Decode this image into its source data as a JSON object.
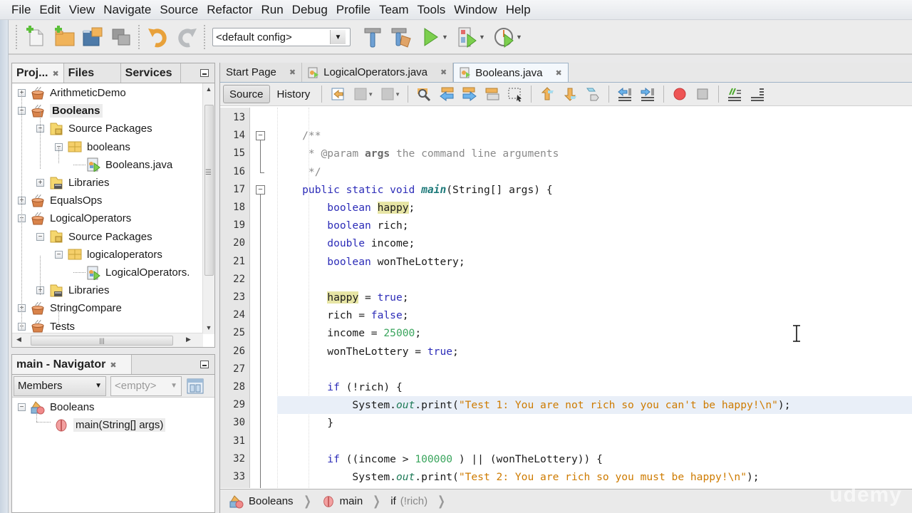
{
  "menubar": {
    "items": [
      "File",
      "Edit",
      "View",
      "Navigate",
      "Source",
      "Refactor",
      "Run",
      "Debug",
      "Profile",
      "Team",
      "Tools",
      "Window",
      "Help"
    ]
  },
  "toolbar": {
    "config_value": "<default config>",
    "buttons": [
      {
        "name": "new-file",
        "icon": "new-file-icon"
      },
      {
        "name": "new-project",
        "icon": "new-project-icon"
      },
      {
        "name": "open-project",
        "icon": "open-project-icon"
      },
      {
        "name": "close-project",
        "icon": "close-project-icon"
      },
      {
        "name": "undo",
        "icon": "undo-icon"
      },
      {
        "name": "redo",
        "icon": "redo-icon"
      },
      {
        "name": "build",
        "icon": "hammer-icon"
      },
      {
        "name": "clean-build",
        "icon": "clean-build-icon"
      },
      {
        "name": "run",
        "icon": "run-icon"
      },
      {
        "name": "debug",
        "icon": "debug-icon"
      },
      {
        "name": "profile",
        "icon": "profile-icon"
      }
    ]
  },
  "projects_panel": {
    "tabs": [
      {
        "label": "Proj...",
        "active": true
      },
      {
        "label": "Files",
        "active": false
      },
      {
        "label": "Services",
        "active": false
      }
    ],
    "tree": [
      {
        "label": "ArithmeticDemo",
        "type": "project",
        "level": 0,
        "expanded": false
      },
      {
        "label": "Booleans",
        "type": "project",
        "level": 0,
        "expanded": true,
        "selected": true
      },
      {
        "label": "Source Packages",
        "type": "source-folder",
        "level": 1,
        "expanded": true
      },
      {
        "label": "booleans",
        "type": "package",
        "level": 2,
        "expanded": true
      },
      {
        "label": "Booleans.java",
        "type": "java-file",
        "level": 3
      },
      {
        "label": "Libraries",
        "type": "libraries",
        "level": 1,
        "expanded": false
      },
      {
        "label": "EqualsOps",
        "type": "project",
        "level": 0,
        "expanded": false
      },
      {
        "label": "LogicalOperators",
        "type": "project",
        "level": 0,
        "expanded": true
      },
      {
        "label": "Source Packages",
        "type": "source-folder",
        "level": 1,
        "expanded": true
      },
      {
        "label": "logicaloperators",
        "type": "package",
        "level": 2,
        "expanded": true
      },
      {
        "label": "LogicalOperators.",
        "type": "java-file",
        "level": 3
      },
      {
        "label": "Libraries",
        "type": "libraries",
        "level": 1,
        "expanded": false
      },
      {
        "label": "StringCompare",
        "type": "project",
        "level": 0,
        "expanded": false
      },
      {
        "label": "Tests",
        "type": "project",
        "level": 0,
        "expanded": true
      }
    ]
  },
  "navigator_panel": {
    "title": "main - Navigator",
    "filter_value": "Members",
    "second_filter": "<empty>",
    "tree": [
      {
        "label": "Booleans",
        "type": "class",
        "level": 0
      },
      {
        "label": "main(String[] args)",
        "type": "method",
        "level": 1,
        "selected": true
      }
    ]
  },
  "editor": {
    "tabs": [
      {
        "label": "Start Page",
        "active": false,
        "icon": false
      },
      {
        "label": "LogicalOperators.java",
        "active": false,
        "icon": true
      },
      {
        "label": "Booleans.java",
        "active": true,
        "icon": true
      }
    ],
    "view_buttons": {
      "source": "Source",
      "history": "History"
    },
    "current_line": 29,
    "lines": [
      {
        "n": "13",
        "t": []
      },
      {
        "n": "14",
        "t": [
          [
            "cmt",
            "    /**"
          ]
        ]
      },
      {
        "n": "15",
        "t": [
          [
            "cmt",
            "     * @param "
          ],
          [
            "cmtb",
            "args"
          ],
          [
            "cmt",
            " the command line arguments"
          ]
        ]
      },
      {
        "n": "16",
        "t": [
          [
            "cmt",
            "     */"
          ]
        ]
      },
      {
        "n": "17",
        "t": [
          [
            "kw",
            "    public static void "
          ],
          [
            "mth",
            "main"
          ],
          [
            "",
            "(String[] args) {"
          ]
        ]
      },
      {
        "n": "18",
        "t": [
          [
            "kw",
            "        boolean "
          ],
          [
            "mark",
            "happy"
          ],
          [
            "",
            ";"
          ]
        ]
      },
      {
        "n": "19",
        "t": [
          [
            "kw",
            "        boolean "
          ],
          [
            "",
            "rich;"
          ]
        ]
      },
      {
        "n": "20",
        "t": [
          [
            "kw",
            "        double "
          ],
          [
            "",
            "income;"
          ]
        ]
      },
      {
        "n": "21",
        "t": [
          [
            "kw",
            "        boolean "
          ],
          [
            "",
            "wonTheLottery;"
          ]
        ]
      },
      {
        "n": "22",
        "t": []
      },
      {
        "n": "23",
        "t": [
          [
            "",
            "        "
          ],
          [
            "mark",
            "happy"
          ],
          [
            "",
            " = "
          ],
          [
            "kw",
            "true"
          ],
          [
            "",
            ";"
          ]
        ]
      },
      {
        "n": "24",
        "t": [
          [
            "",
            "        rich = "
          ],
          [
            "kw",
            "false"
          ],
          [
            "",
            ";"
          ]
        ]
      },
      {
        "n": "25",
        "t": [
          [
            "",
            "        income = "
          ],
          [
            "num",
            "25000"
          ],
          [
            "",
            ";"
          ]
        ]
      },
      {
        "n": "26",
        "t": [
          [
            "",
            "        wonTheLottery = "
          ],
          [
            "kw",
            "true"
          ],
          [
            "",
            ";"
          ]
        ]
      },
      {
        "n": "27",
        "t": []
      },
      {
        "n": "28",
        "t": [
          [
            "kw",
            "        if "
          ],
          [
            "",
            "(!rich) {"
          ]
        ]
      },
      {
        "n": "29",
        "t": [
          [
            "",
            "            System."
          ],
          [
            "fld",
            "out"
          ],
          [
            "",
            ".print("
          ],
          [
            "str",
            "\"Test 1: You are not rich so you can't be happy!\\n\""
          ],
          [
            "",
            ");"
          ]
        ]
      },
      {
        "n": "30",
        "t": [
          [
            "",
            "        }"
          ]
        ]
      },
      {
        "n": "31",
        "t": []
      },
      {
        "n": "32",
        "t": [
          [
            "kw",
            "        if "
          ],
          [
            "",
            "((income > "
          ],
          [
            "num",
            "100000"
          ],
          [
            "",
            " ) || (wonTheLottery)) {"
          ]
        ]
      },
      {
        "n": "33",
        "t": [
          [
            "",
            "            System."
          ],
          [
            "fld",
            "out"
          ],
          [
            "",
            ".print("
          ],
          [
            "str",
            "\"Test 2: You are rich so you must be happy!\\n\""
          ],
          [
            "",
            ");"
          ]
        ]
      }
    ],
    "breadcrumb": [
      {
        "label": "Booleans",
        "icon": "class-icon"
      },
      {
        "label": "main",
        "icon": "method-icon"
      },
      {
        "label": "if",
        "muted": "(!rich)"
      }
    ],
    "watermark": "udemy"
  }
}
